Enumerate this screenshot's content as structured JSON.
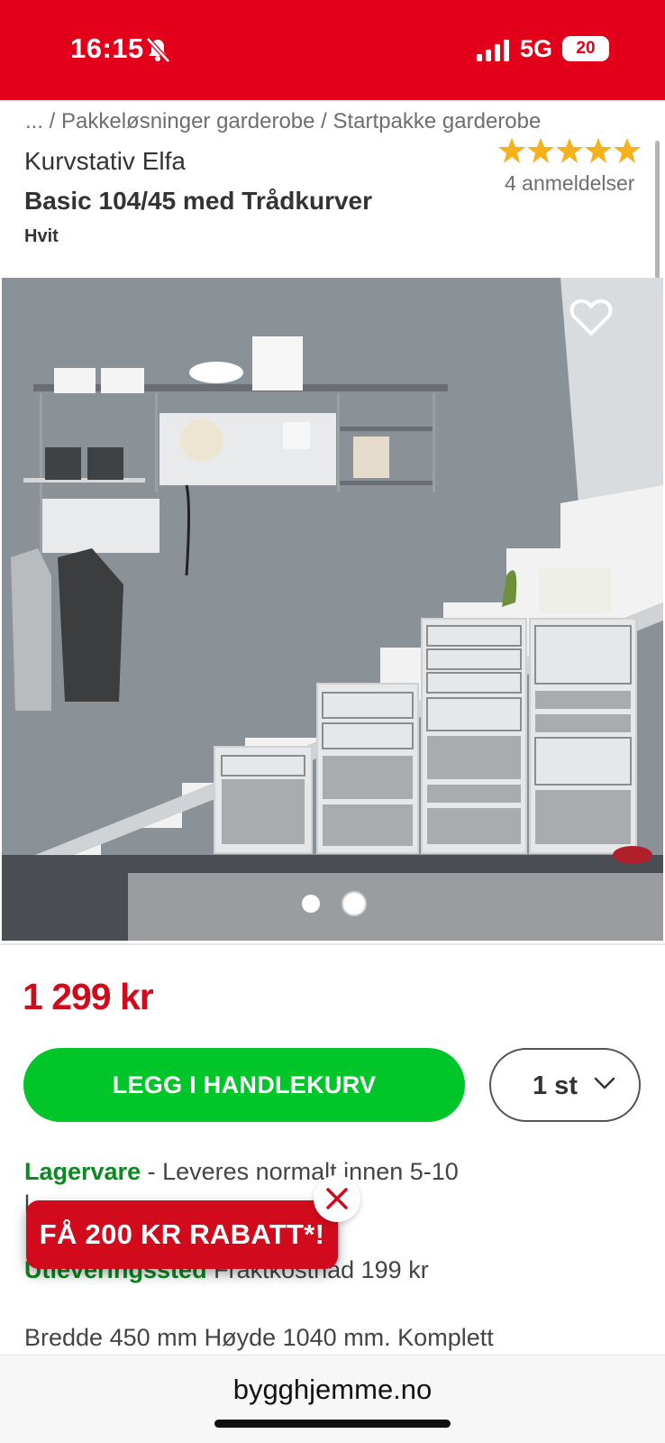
{
  "status_bar": {
    "time": "16:15",
    "network": "5G",
    "battery": "20"
  },
  "breadcrumb": "... / Pakkeløsninger garderobe / Startpakke garderobe",
  "product": {
    "brand_line": "Kurvstativ Elfa",
    "title": "Basic 104/45 med Trådkurver",
    "variant": "Hvit",
    "rating": 5,
    "reviews_label": "4 anmeldelser",
    "price": "1 299 kr",
    "image_count": 2,
    "active_image": 2
  },
  "actions": {
    "add_to_cart_label": "LEGG I HANDLEKURV",
    "quantity_value": "1 st"
  },
  "stock": {
    "status": "Lagervare",
    "text": " - Leveres normalt innen 5-10",
    "text_cont": "l",
    "pickup_label": "Utleveringssted",
    "pickup_text": " Fraktkostnad 199 kr"
  },
  "description_line": "Bredde 450 mm Høyde 1040 mm. Komplett",
  "promo": {
    "label": "FÅ 200 KR RABATT*!"
  },
  "browser": {
    "url": "bygghjemme.no"
  },
  "colors": {
    "brand_red": "#e3001b",
    "price_red": "#d10a1c",
    "cart_green": "#00c62a",
    "stock_green": "#0a8a1f",
    "star_yellow": "#f6b21a"
  },
  "icons": [
    "bell-slash-icon",
    "signal-icon",
    "battery-icon",
    "star-icon",
    "heart-icon",
    "chevron-down-icon",
    "close-icon"
  ]
}
